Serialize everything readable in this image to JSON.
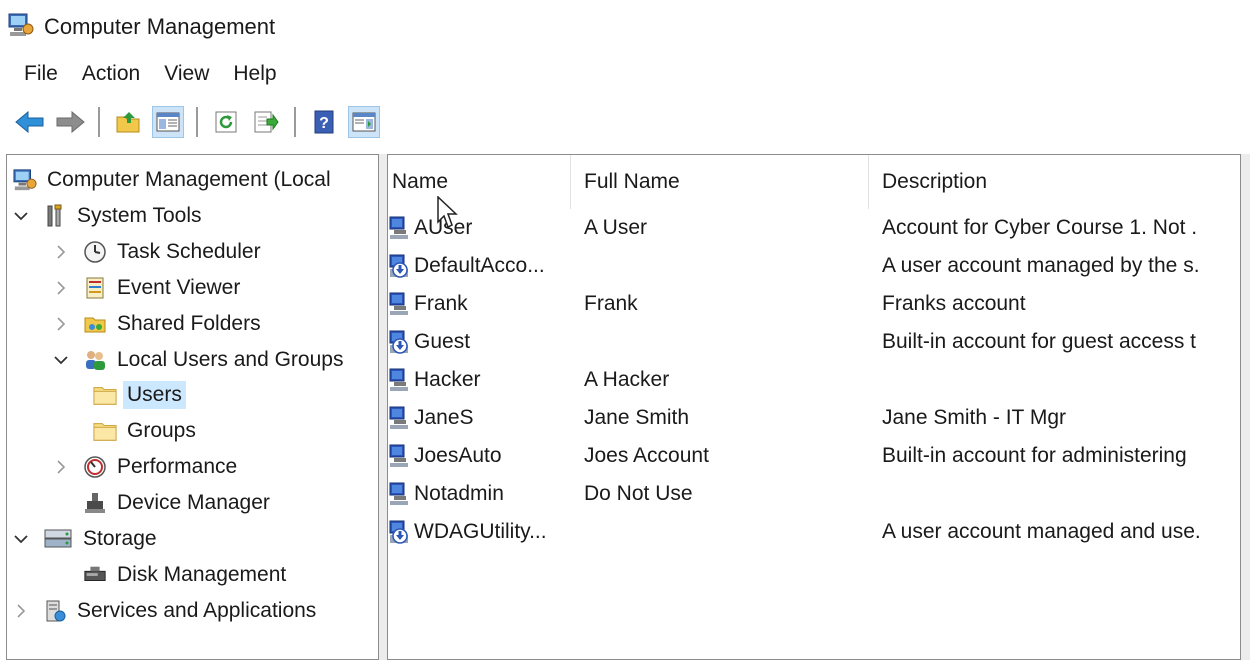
{
  "window": {
    "title": "Computer Management",
    "icon": "computer-management-icon"
  },
  "menu": [
    "File",
    "Action",
    "View",
    "Help"
  ],
  "toolbar": [
    {
      "name": "back-button",
      "icon": "back-arrow-icon"
    },
    {
      "name": "forward-button",
      "icon": "forward-arrow-icon"
    },
    {
      "name": "up-one-level-button",
      "icon": "folder-up-icon"
    },
    {
      "name": "show-hide-console-tree-button",
      "icon": "console-tree-icon",
      "pressed": true
    },
    {
      "name": "refresh-button",
      "icon": "refresh-icon"
    },
    {
      "name": "export-list-button",
      "icon": "export-list-icon"
    },
    {
      "name": "help-button",
      "icon": "help-icon"
    },
    {
      "name": "show-hide-action-pane-button",
      "icon": "action-pane-icon",
      "pressed": true
    }
  ],
  "tree": [
    {
      "label": "Computer Management (Local",
      "icon": "computer-management-icon",
      "expander": "none",
      "depth": 0
    },
    {
      "label": "System Tools",
      "icon": "tools-icon",
      "expander": "expanded",
      "depth": 0
    },
    {
      "label": "Task Scheduler",
      "icon": "clock-icon",
      "expander": "collapsed",
      "depth": 1
    },
    {
      "label": "Event Viewer",
      "icon": "event-viewer-icon",
      "expander": "collapsed",
      "depth": 1
    },
    {
      "label": "Shared Folders",
      "icon": "shared-folders-icon",
      "expander": "collapsed",
      "depth": 1
    },
    {
      "label": "Local Users and Groups",
      "icon": "users-group-icon",
      "expander": "expanded",
      "depth": 1
    },
    {
      "label": "Users",
      "icon": "folder-icon",
      "expander": "none",
      "depth": 2,
      "selected": true
    },
    {
      "label": "Groups",
      "icon": "folder-icon",
      "expander": "none",
      "depth": 2
    },
    {
      "label": "Performance",
      "icon": "performance-icon",
      "expander": "collapsed",
      "depth": 1
    },
    {
      "label": "Device Manager",
      "icon": "device-manager-icon",
      "expander": "none",
      "depth": 1
    },
    {
      "label": "Storage",
      "icon": "storage-icon",
      "expander": "expanded",
      "depth": 0
    },
    {
      "label": "Disk Management",
      "icon": "disk-management-icon",
      "expander": "none",
      "depth": 1
    },
    {
      "label": "Services and Applications",
      "icon": "services-icon",
      "expander": "collapsed",
      "depth": 0
    }
  ],
  "columns": [
    "Name",
    "Full Name",
    "Description"
  ],
  "users": [
    {
      "name": "AUser",
      "full_name": "A User",
      "description": "Account for Cyber Course 1. Not .",
      "icon": "user-icon"
    },
    {
      "name": "DefaultAcco...",
      "full_name": "",
      "description": "A user account managed by the s.",
      "icon": "disabled-user-icon"
    },
    {
      "name": "Frank",
      "full_name": "Frank",
      "description": "Franks account",
      "icon": "user-icon"
    },
    {
      "name": "Guest",
      "full_name": "",
      "description": "Built-in account for guest access t",
      "icon": "disabled-user-icon"
    },
    {
      "name": "Hacker",
      "full_name": "A Hacker",
      "description": "",
      "icon": "user-icon"
    },
    {
      "name": "JaneS",
      "full_name": "Jane Smith",
      "description": "Jane Smith - IT Mgr",
      "icon": "user-icon"
    },
    {
      "name": "JoesAuto",
      "full_name": "Joes Account",
      "description": "Built-in account for administering",
      "icon": "user-icon"
    },
    {
      "name": "Notadmin",
      "full_name": "Do Not Use",
      "description": "",
      "icon": "user-icon"
    },
    {
      "name": "WDAGUtility...",
      "full_name": "",
      "description": "A user account managed and use.",
      "icon": "disabled-user-icon"
    }
  ]
}
